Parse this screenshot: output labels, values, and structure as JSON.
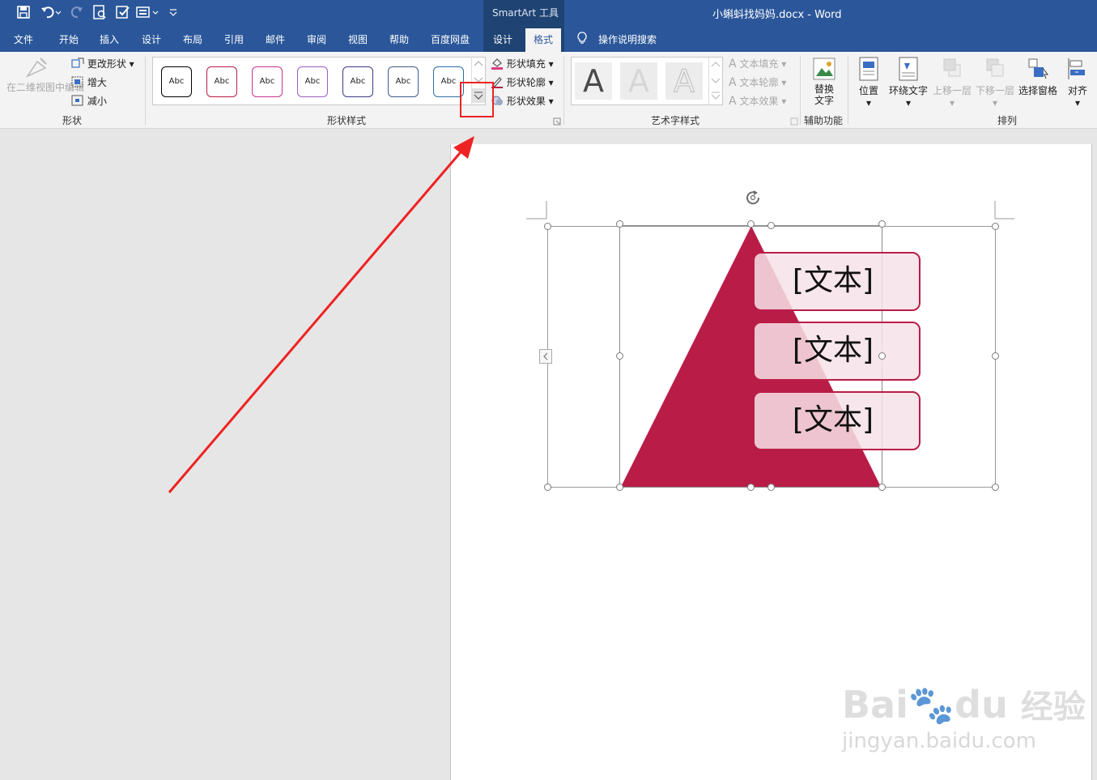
{
  "app": {
    "doc_title": "小蝌蚪找妈妈.docx  -  Word",
    "context_group": "SmartArt 工具"
  },
  "tabs": [
    {
      "label": "文件"
    },
    {
      "label": "开始"
    },
    {
      "label": "插入"
    },
    {
      "label": "设计"
    },
    {
      "label": "布局"
    },
    {
      "label": "引用"
    },
    {
      "label": "邮件"
    },
    {
      "label": "审阅"
    },
    {
      "label": "视图"
    },
    {
      "label": "帮助"
    },
    {
      "label": "百度网盘"
    },
    {
      "label": "设计"
    },
    {
      "label": "格式",
      "active": true
    }
  ],
  "search_label": "操作说明搜索",
  "ribbon": {
    "shape_group": {
      "label": "形状",
      "edit_2d": "在二维视图中编辑",
      "change_shape": "更改形状",
      "larger": "增大",
      "smaller": "减小"
    },
    "shape_styles": {
      "label": "形状样式",
      "preview_text": "Abc",
      "previews": [
        "#000000",
        "#b91d47",
        "#c9358e",
        "#a05cc2",
        "#3b3b8a",
        "#3e5b8e",
        "#2d6fa3"
      ],
      "fill": "形状填充",
      "outline": "形状轮廓",
      "effects": "形状效果"
    },
    "wordart": {
      "label": "艺术字样式",
      "glyph": "A",
      "text_fill": "文本填充",
      "text_outline": "文本轮廓",
      "text_effects": "文本效果"
    },
    "accessibility": {
      "label": "辅助功能",
      "alt_text": "替换文字"
    },
    "arrange": {
      "label": "排列",
      "position": "位置",
      "wrap_text": "环绕文字",
      "bring_forward": "上移一层",
      "send_backward": "下移一层",
      "selection_pane": "选择窗格",
      "align": "对齐"
    }
  },
  "smartart": {
    "fill_color": "#b91d47",
    "items": [
      "[文本]",
      "[文本]",
      "[文本]"
    ]
  },
  "watermark": {
    "brand": "Bai",
    "brand2": "du",
    "brand_cn": "经验",
    "url": "jingyan.baidu.com"
  },
  "colors": {
    "title_blue": "#2b579a",
    "accent": "#b91d47",
    "highlight": "#ee2222"
  }
}
